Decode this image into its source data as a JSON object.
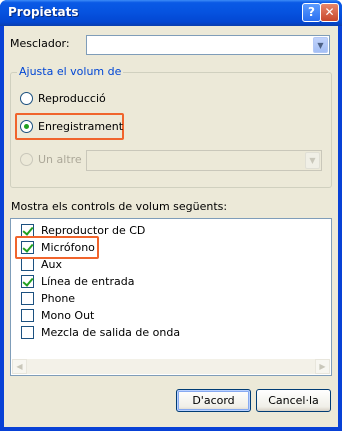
{
  "window": {
    "title": "Propietats",
    "help_label": "?",
    "close_label": "✕"
  },
  "mixer": {
    "label": "Mesclador:",
    "value": ""
  },
  "group": {
    "title": "Ajusta el volum de",
    "options": [
      {
        "label": "Reproducció",
        "selected": false,
        "enabled": true
      },
      {
        "label": "Enregistrament",
        "selected": true,
        "enabled": true
      },
      {
        "label": "Un altre",
        "selected": false,
        "enabled": false
      }
    ],
    "other_value": ""
  },
  "controls": {
    "label": "Mostra els controls de volum següents:",
    "items": [
      {
        "label": "Reproductor de CD",
        "checked": true
      },
      {
        "label": "Micrófono",
        "checked": true
      },
      {
        "label": "Aux",
        "checked": false
      },
      {
        "label": "Línea de entrada",
        "checked": true
      },
      {
        "label": "Phone",
        "checked": false
      },
      {
        "label": "Mono Out",
        "checked": false
      },
      {
        "label": "Mezcla de salida de onda",
        "checked": false
      }
    ]
  },
  "buttons": {
    "ok": "D'acord",
    "cancel": "Cancel·la"
  },
  "icons": {
    "dropdown": "chevron-down-icon",
    "scroll_left": "arrow-left-icon",
    "scroll_right": "arrow-right-icon"
  },
  "colors": {
    "titlebar": "#0653e0",
    "highlight": "#f0642c",
    "check": "#21a121",
    "group_title": "#0046d5"
  }
}
